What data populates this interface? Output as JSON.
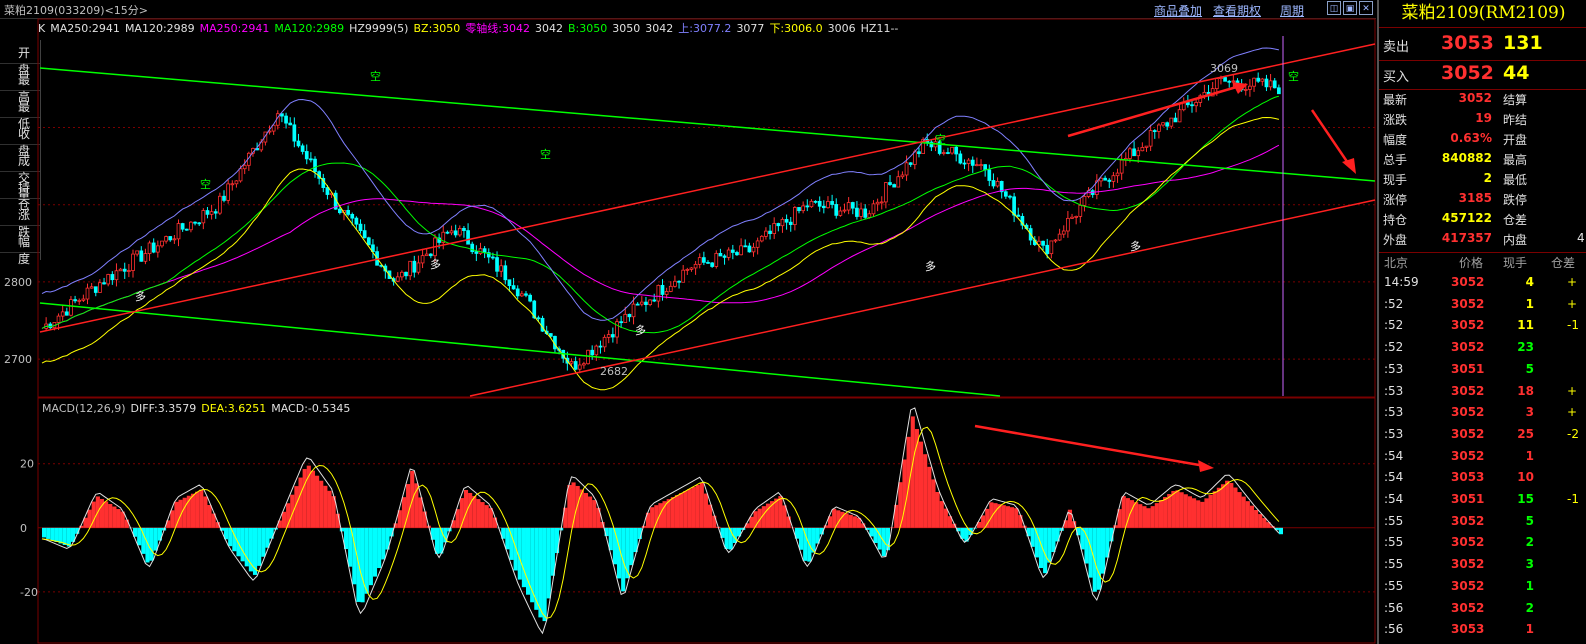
{
  "window": {
    "title": "菜粕2109(033209)<15分>",
    "links": [
      "商品叠加",
      "查看期权",
      "周期"
    ],
    "controls": [
      "restore-icon",
      "maximize-icon",
      "close-icon"
    ]
  },
  "left_panel": {
    "rows": [
      "开盘",
      "最高",
      "最低",
      "收盘",
      "成交量",
      "持仓",
      "涨跌",
      "幅度"
    ]
  },
  "indicator_bar": {
    "items": [
      {
        "text": "K",
        "color": "#e0e0e0"
      },
      {
        "text": "MA250:2941",
        "color": "#e0e0e0"
      },
      {
        "text": "MA120:2989",
        "color": "#e0e0e0"
      },
      {
        "text": "MA250:2941",
        "color": "#ff00ff"
      },
      {
        "text": "MA120:2989",
        "color": "#00ff00"
      },
      {
        "text": "HZ9999(5)",
        "color": "#e0e0e0"
      },
      {
        "text": "BZ:3050",
        "color": "#ffff00"
      },
      {
        "text": "零轴线:3042",
        "color": "#ff00ff"
      },
      {
        "text": "3042",
        "color": "#e0e0e0"
      },
      {
        "text": "B:3050",
        "color": "#00ff00"
      },
      {
        "text": "3050",
        "color": "#e0e0e0"
      },
      {
        "text": "3042",
        "color": "#e0e0e0"
      },
      {
        "text": "上:3077.2",
        "color": "#8080ff"
      },
      {
        "text": "3077",
        "color": "#e0e0e0"
      },
      {
        "text": "下:3006.0",
        "color": "#ffff00"
      },
      {
        "text": "3006",
        "color": "#e0e0e0"
      },
      {
        "text": "HZ11--",
        "color": "#e0e0e0"
      }
    ]
  },
  "price_axis": [
    "2800",
    "2700"
  ],
  "price_annotations": {
    "low": "2682",
    "high": "3069",
    "tags": [
      "空",
      "多"
    ]
  },
  "macd_bar": {
    "items": [
      {
        "text": "MACD(12,26,9)",
        "color": "#c0c0c0"
      },
      {
        "text": "DIFF:3.3579",
        "color": "#e0e0e0"
      },
      {
        "text": "DEA:3.6251",
        "color": "#ffff00"
      },
      {
        "text": "MACD:-0.5345",
        "color": "#e0e0e0"
      }
    ]
  },
  "macd_axis": [
    "20",
    "0",
    "-20"
  ],
  "chart_data": [
    {
      "type": "candlestick",
      "title": "菜粕2109 15分",
      "price_range": [
        2660,
        3090
      ],
      "approx_path": [
        2740,
        2800,
        2850,
        2900,
        3020,
        2900,
        2800,
        2870,
        2800,
        2690,
        2760,
        2820,
        2840,
        2900,
        2890,
        2980,
        2950,
        2840,
        2930,
        3000,
        3060,
        3052
      ],
      "marked_low": 2682,
      "marked_high": 3069
    },
    {
      "type": "bar",
      "title": "MACD(12,26,9)",
      "ylim": [
        -35,
        38
      ],
      "values": [
        -3,
        -6,
        10,
        5,
        -12,
        8,
        12,
        -5,
        -15,
        3,
        20,
        10,
        -25,
        -8,
        18,
        -10,
        12,
        6,
        -15,
        -30,
        15,
        8,
        -20,
        6,
        10,
        14,
        -8,
        5,
        10,
        -12,
        6,
        3,
        -10,
        35,
        10,
        -5,
        8,
        6,
        -15,
        6,
        -22,
        10,
        6,
        12,
        8,
        15,
        6,
        -2
      ],
      "series": [
        {
          "name": "DIFF",
          "color": "#e0e0e0"
        },
        {
          "name": "DEA",
          "color": "#ffff00"
        }
      ]
    }
  ],
  "quote": {
    "title": "菜粕2109(RM2109)",
    "ask": {
      "label": "卖出",
      "price": "3053",
      "volume": "131"
    },
    "bid": {
      "label": "买入",
      "price": "3052",
      "volume": "44"
    },
    "rows": [
      {
        "k1": "最新",
        "v1": "3052",
        "c1": "#ff3030",
        "k2": "结算",
        "v2": ""
      },
      {
        "k1": "涨跌",
        "v1": "19",
        "c1": "#ff3030",
        "k2": "昨结",
        "v2": ""
      },
      {
        "k1": "幅度",
        "v1": "0.63%",
        "c1": "#ff3030",
        "k2": "开盘",
        "v2": ""
      },
      {
        "k1": "总手",
        "v1": "840882",
        "c1": "#ffff00",
        "k2": "最高",
        "v2": ""
      },
      {
        "k1": "现手",
        "v1": "2",
        "c1": "#ffff00",
        "k2": "最低",
        "v2": ""
      },
      {
        "k1": "涨停",
        "v1": "3185",
        "c1": "#ff3030",
        "k2": "跌停",
        "v2": ""
      },
      {
        "k1": "持仓",
        "v1": "457122",
        "c1": "#ffff00",
        "k2": "仓差",
        "v2": ""
      },
      {
        "k1": "外盘",
        "v1": "417357",
        "c1": "#ff3030",
        "k2": "内盘",
        "v2": "4"
      }
    ],
    "ticks_header": [
      "北京",
      "价格",
      "现手",
      "仓差"
    ],
    "ticks": [
      {
        "time": "14:59",
        "price": "3052",
        "vol": "4",
        "vcolor": "#ffff00",
        "chg": "+",
        "ccolor": "#ffff00"
      },
      {
        "time": ":52",
        "price": "3052",
        "vol": "1",
        "vcolor": "#ffff00",
        "chg": "+",
        "ccolor": "#ffff00"
      },
      {
        "time": ":52",
        "price": "3052",
        "vol": "11",
        "vcolor": "#ffff00",
        "chg": "-1",
        "ccolor": "#ffff00"
      },
      {
        "time": ":52",
        "price": "3052",
        "vol": "23",
        "vcolor": "#00ff00",
        "chg": "",
        "ccolor": "#ffff00"
      },
      {
        "time": ":53",
        "price": "3051",
        "vol": "5",
        "vcolor": "#00ff00",
        "chg": "",
        "ccolor": "#ffff00"
      },
      {
        "time": ":53",
        "price": "3052",
        "vol": "18",
        "vcolor": "#ff3030",
        "chg": "+",
        "ccolor": "#ffff00"
      },
      {
        "time": ":53",
        "price": "3052",
        "vol": "3",
        "vcolor": "#ff3030",
        "chg": "+",
        "ccolor": "#ffff00"
      },
      {
        "time": ":53",
        "price": "3052",
        "vol": "25",
        "vcolor": "#ff3030",
        "chg": "-2",
        "ccolor": "#ffff00"
      },
      {
        "time": ":54",
        "price": "3052",
        "vol": "1",
        "vcolor": "#ff3030",
        "chg": "",
        "ccolor": "#ffff00"
      },
      {
        "time": ":54",
        "price": "3053",
        "vol": "10",
        "vcolor": "#ff3030",
        "chg": "",
        "ccolor": "#ffff00"
      },
      {
        "time": ":54",
        "price": "3051",
        "vol": "15",
        "vcolor": "#00ff00",
        "chg": "-1",
        "ccolor": "#ffff00"
      },
      {
        "time": ":55",
        "price": "3052",
        "vol": "5",
        "vcolor": "#00ff00",
        "chg": "",
        "ccolor": "#ffff00"
      },
      {
        "time": ":55",
        "price": "3052",
        "vol": "2",
        "vcolor": "#00ff00",
        "chg": "",
        "ccolor": "#ffff00"
      },
      {
        "time": ":55",
        "price": "3052",
        "vol": "3",
        "vcolor": "#00ff00",
        "chg": "",
        "ccolor": "#ffff00"
      },
      {
        "time": ":55",
        "price": "3052",
        "vol": "1",
        "vcolor": "#00ff00",
        "chg": "",
        "ccolor": "#ffff00"
      },
      {
        "time": ":56",
        "price": "3052",
        "vol": "2",
        "vcolor": "#00ff00",
        "chg": "",
        "ccolor": "#ffff00"
      },
      {
        "time": ":56",
        "price": "3053",
        "vol": "1",
        "vcolor": "#ff3030",
        "chg": "",
        "ccolor": "#ffff00"
      }
    ]
  },
  "colors": {
    "up": "#ff3030",
    "down": "#00ffff",
    "grid": "#7a0000",
    "trend_red": "#ff2020",
    "trend_green": "#00ff00"
  }
}
